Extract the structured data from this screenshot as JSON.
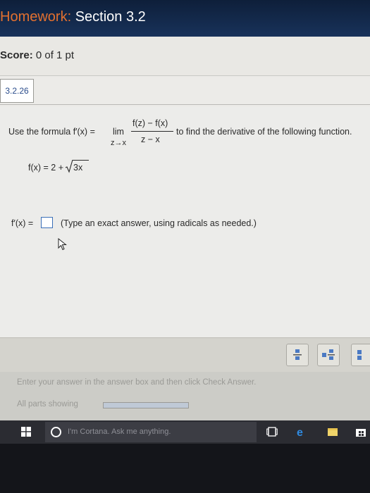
{
  "header": {
    "prefix": "Homework:",
    "section": "Section 3.2"
  },
  "score": {
    "label": "Score:",
    "value": "0 of 1 pt"
  },
  "problem": {
    "id": "3.2.26",
    "instruction_start": "Use the formula f′(x) =",
    "lim_word": "lim",
    "lim_sub": "z→x",
    "numerator": "f(z) − f(x)",
    "denominator": "z − x",
    "instruction_end": "to find the derivative of the following function.",
    "function_prefix": "f(x) = 2 +",
    "radicand": "3x",
    "answer_label": "f′(x) =",
    "answer_value": "",
    "answer_hint": "(Type an exact answer, using radicals as needed.)"
  },
  "help": {
    "text": "Enter your answer in the answer box and then click Check Answer.",
    "parts_label": "All parts showing",
    "parts_progress": 1.0
  },
  "taskbar": {
    "cortana_placeholder": "I'm Cortana. Ask me anything."
  },
  "colors": {
    "header_bg": "#18325a",
    "header_accent": "#e2702f",
    "answer_box_border": "#3a6fb8",
    "taskbar_bg": "#2b2c32"
  },
  "icons": {
    "start": "windows-logo-icon",
    "cortana": "cortana-ring-icon",
    "task_view": "task-view-icon",
    "edge": "edge-browser-icon",
    "explorer": "file-explorer-icon",
    "store": "store-icon",
    "cursor": "mouse-pointer-icon"
  }
}
